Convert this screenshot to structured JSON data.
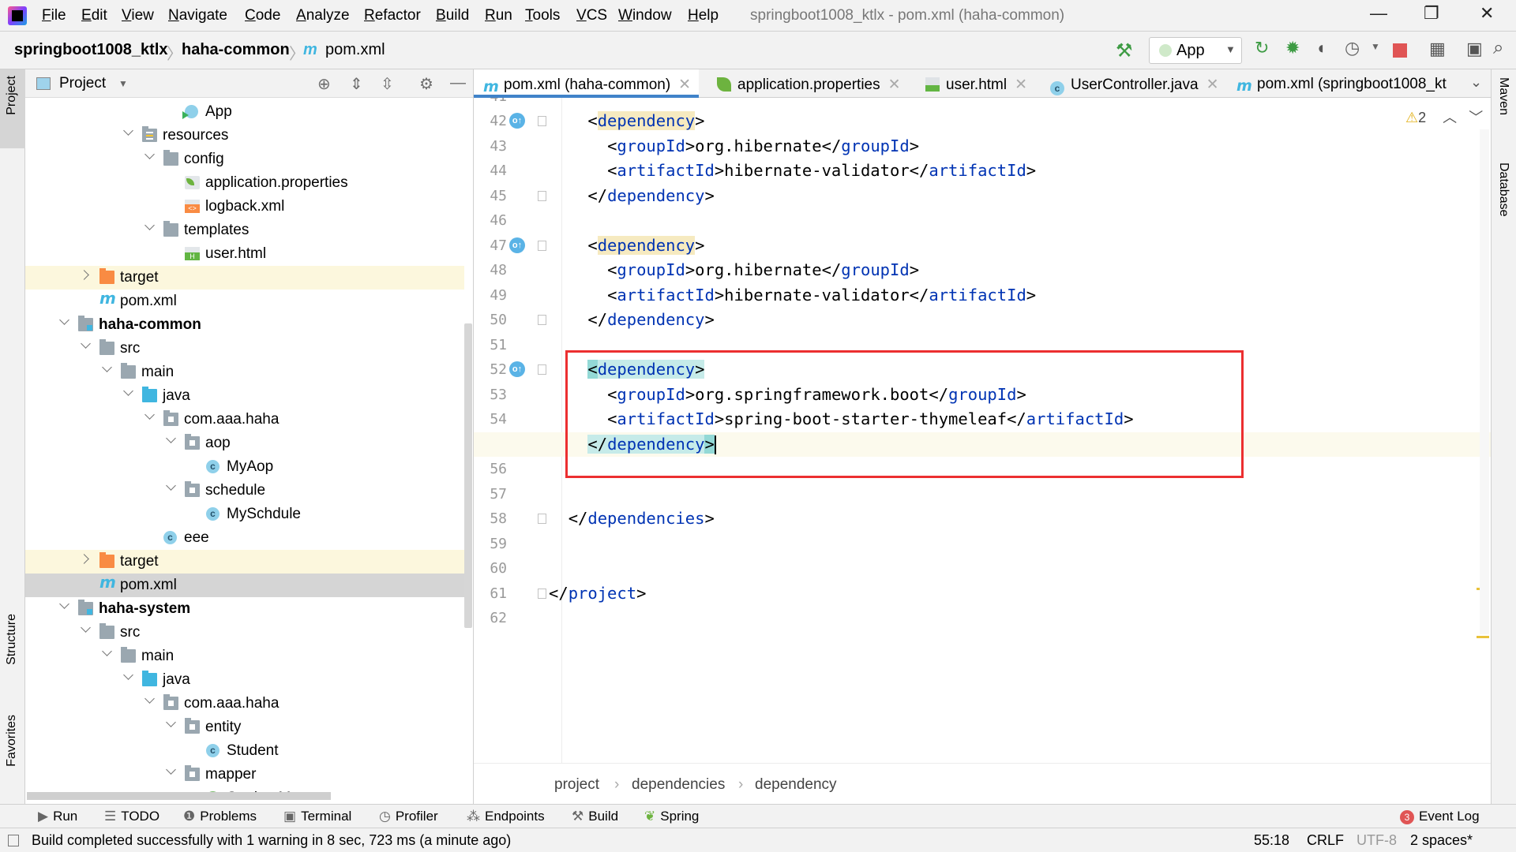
{
  "menu": [
    "File",
    "Edit",
    "View",
    "Navigate",
    "Code",
    "Analyze",
    "Refactor",
    "Build",
    "Run",
    "Tools",
    "VCS",
    "Window",
    "Help"
  ],
  "window_title": "springboot1008_ktlx - pom.xml (haha-common)",
  "window_controls": {
    "minimize": "—",
    "restore": "❐",
    "close": "✕"
  },
  "breadcrumb": {
    "project": "springboot1008_ktlx",
    "module": "haha-common",
    "file": "pom.xml",
    "file_icon": "m"
  },
  "toolbar": {
    "run_config": "App",
    "icons": [
      "hammer-icon",
      "rerun-icon",
      "debug-icon",
      "coverage-icon",
      "profiler-icon",
      "stop-icon",
      "project-structure-icon",
      "run-anything-icon",
      "search-icon"
    ],
    "stop_color": "#e05555"
  },
  "left_strip": {
    "project": "Project",
    "structure": "Structure",
    "favorites": "Favorites"
  },
  "right_strip": {
    "maven": "Maven",
    "database": "Database"
  },
  "project_panel": {
    "title": "Project",
    "tree": [
      {
        "label": "App",
        "level": 5,
        "icon": "app"
      },
      {
        "label": "resources",
        "level": 3,
        "icon": "res",
        "expanded": true
      },
      {
        "label": "config",
        "level": 4,
        "icon": "folder",
        "expanded": true
      },
      {
        "label": "application.properties",
        "level": 5,
        "icon": "props"
      },
      {
        "label": "logback.xml",
        "level": 5,
        "icon": "xml"
      },
      {
        "label": "templates",
        "level": 4,
        "icon": "folder",
        "expanded": true
      },
      {
        "label": "user.html",
        "level": 5,
        "icon": "html"
      },
      {
        "label": "target",
        "level": 1,
        "icon": "target",
        "expanded": false,
        "highlight": true
      },
      {
        "label": "pom.xml",
        "level": 1,
        "icon": "maven"
      },
      {
        "label": "haha-common",
        "level": 0,
        "icon": "module",
        "expanded": true,
        "bold": true
      },
      {
        "label": "src",
        "level": 1,
        "icon": "folder",
        "expanded": true
      },
      {
        "label": "main",
        "level": 2,
        "icon": "folder",
        "expanded": true
      },
      {
        "label": "java",
        "level": 3,
        "icon": "src",
        "expanded": true
      },
      {
        "label": "com.aaa.haha",
        "level": 4,
        "icon": "pkg",
        "expanded": true
      },
      {
        "label": "aop",
        "level": 5,
        "icon": "pkg",
        "expanded": true
      },
      {
        "label": "MyAop",
        "level": 6,
        "icon": "class"
      },
      {
        "label": "schedule",
        "level": 5,
        "icon": "pkg",
        "expanded": true
      },
      {
        "label": "MySchdule",
        "level": 6,
        "icon": "class"
      },
      {
        "label": "eee",
        "level": 4,
        "icon": "class"
      },
      {
        "label": "target",
        "level": 1,
        "icon": "target",
        "expanded": false,
        "highlight": true
      },
      {
        "label": "pom.xml",
        "level": 1,
        "icon": "maven",
        "selected": true
      },
      {
        "label": "haha-system",
        "level": 0,
        "icon": "module",
        "expanded": true,
        "bold": true
      },
      {
        "label": "src",
        "level": 1,
        "icon": "folder",
        "expanded": true
      },
      {
        "label": "main",
        "level": 2,
        "icon": "folder",
        "expanded": true
      },
      {
        "label": "java",
        "level": 3,
        "icon": "src",
        "expanded": true
      },
      {
        "label": "com.aaa.haha",
        "level": 4,
        "icon": "pkg",
        "expanded": true
      },
      {
        "label": "entity",
        "level": 5,
        "icon": "pkg",
        "expanded": true
      },
      {
        "label": "Student",
        "level": 6,
        "icon": "class"
      },
      {
        "label": "mapper",
        "level": 5,
        "icon": "pkg",
        "expanded": true
      },
      {
        "label": "StudentMapper",
        "level": 6,
        "icon": "iface"
      }
    ]
  },
  "tabs": [
    {
      "label": "pom.xml (haha-common)",
      "icon": "maven",
      "active": true
    },
    {
      "label": "application.properties",
      "icon": "props"
    },
    {
      "label": "user.html",
      "icon": "html"
    },
    {
      "label": "UserController.java",
      "icon": "class"
    },
    {
      "label": "pom.xml (springboot1008_kt",
      "icon": "maven"
    }
  ],
  "editor": {
    "warnings": "2",
    "caret_line": 55,
    "lines": [
      {
        "n": 41,
        "text": ""
      },
      {
        "n": 42,
        "text": "    <dependency>",
        "hl": "dup",
        "gutter_icon": true,
        "fold": true
      },
      {
        "n": 43,
        "text": "      <groupId>org.hibernate</groupId>"
      },
      {
        "n": 44,
        "text": "      <artifactId>hibernate-validator</artifactId>"
      },
      {
        "n": 45,
        "text": "    </dependency>",
        "fold": true
      },
      {
        "n": 46,
        "text": ""
      },
      {
        "n": 47,
        "text": "    <dependency>",
        "hl": "dup",
        "gutter_icon": true,
        "fold": true
      },
      {
        "n": 48,
        "text": "      <groupId>org.hibernate</groupId>"
      },
      {
        "n": 49,
        "text": "      <artifactId>hibernate-validator</artifactId>"
      },
      {
        "n": 50,
        "text": "    </dependency>",
        "fold": true
      },
      {
        "n": 51,
        "text": ""
      },
      {
        "n": 52,
        "text": "    <dependency>",
        "hl": "match",
        "gutter_icon": true,
        "fold": true
      },
      {
        "n": 53,
        "text": "      <groupId>org.springframework.boot</groupId>"
      },
      {
        "n": 54,
        "text": "      <artifactId>spring-boot-starter-thymeleaf</artifactId>"
      },
      {
        "n": 55,
        "text": "    </dependency>",
        "hl": "match",
        "fold": true
      },
      {
        "n": 56,
        "text": ""
      },
      {
        "n": 57,
        "text": ""
      },
      {
        "n": 58,
        "text": "  </dependencies>",
        "fold": true
      },
      {
        "n": 59,
        "text": ""
      },
      {
        "n": 60,
        "text": ""
      },
      {
        "n": 61,
        "text": "</project>",
        "fold": true
      },
      {
        "n": 62,
        "text": ""
      }
    ],
    "crumbs": [
      "project",
      "dependencies",
      "dependency"
    ],
    "colors": {
      "tag": "#0033b3",
      "annotation_box": "#ec2f30"
    }
  },
  "toolwindows": [
    "Run",
    "TODO",
    "Problems",
    "Terminal",
    "Profiler",
    "Endpoints",
    "Build",
    "Spring"
  ],
  "event_log": {
    "label": "Event Log",
    "count": "3"
  },
  "status": {
    "message": "Build completed successfully with 1 warning in 8 sec, 723 ms (a minute ago)",
    "position": "55:18",
    "line_sep": "CRLF",
    "encoding": "UTF-8",
    "indent": "2 spaces*"
  }
}
